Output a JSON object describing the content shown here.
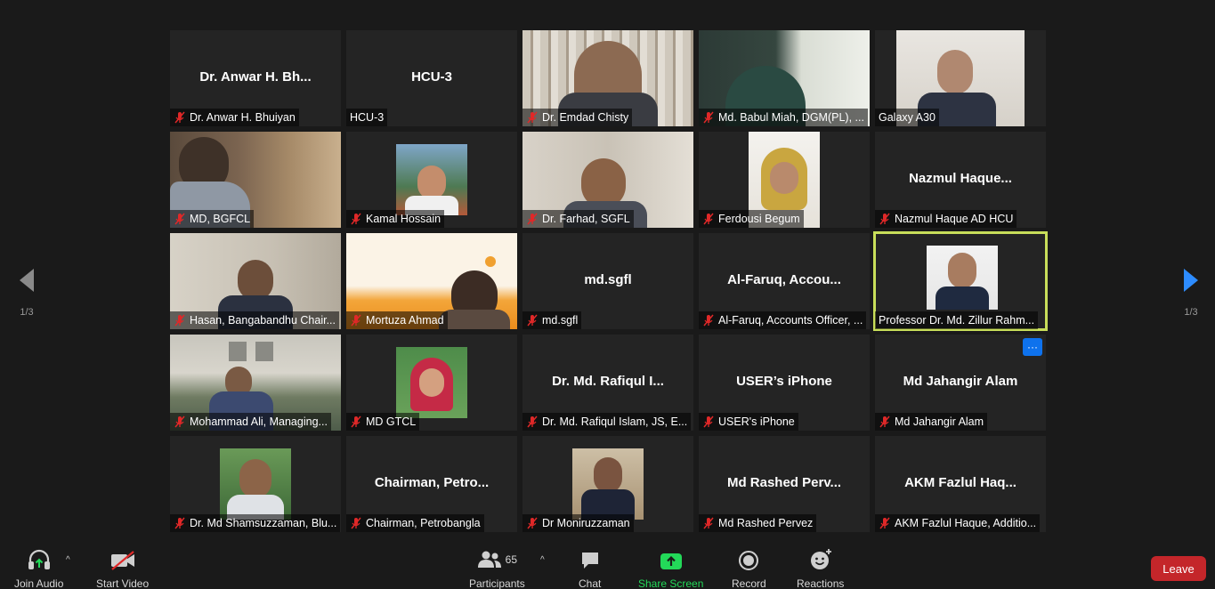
{
  "pager": {
    "left_label": "1/3",
    "right_label": "1/3"
  },
  "tiles": [
    {
      "name": "Dr. Anwar H. Bhuiyan",
      "display": "Dr. Anwar H. Bh...",
      "muted": true
    },
    {
      "name": "HCU-3",
      "display": "HCU-3",
      "muted": false
    },
    {
      "name": "Dr. Emdad Chisty",
      "muted": true
    },
    {
      "name": "Md. Babul Miah, DGM(PL), ...",
      "muted": true
    },
    {
      "name": "Galaxy A30",
      "muted": false
    },
    {
      "name": "MD, BGFCL",
      "muted": true
    },
    {
      "name": "Kamal Hossain",
      "muted": true
    },
    {
      "name": "Dr. Farhad, SGFL",
      "muted": true
    },
    {
      "name": "Ferdousi Begum",
      "muted": true
    },
    {
      "name": "Nazmul Haque AD HCU",
      "display": "Nazmul  Haque...",
      "muted": true
    },
    {
      "name": "Hasan, Bangabandhu Chair...",
      "muted": true
    },
    {
      "name": "Mortuza Ahmad",
      "muted": true
    },
    {
      "name": "md.sgfl",
      "display": "md.sgfl",
      "muted": true
    },
    {
      "name": "Al-Faruq, Accounts Officer, ...",
      "display": "Al-Faruq,  Accou...",
      "muted": true
    },
    {
      "name": "Professor Dr. Md. Zillur Rahm...",
      "muted": false
    },
    {
      "name": "Mohammad Ali, Managing...",
      "muted": true
    },
    {
      "name": "MD GTCL",
      "muted": true
    },
    {
      "name": "Dr. Md. Rafiqul Islam, JS, E...",
      "display": "Dr.  Md.  Rafiqul  I...",
      "muted": true
    },
    {
      "name": "USER's iPhone",
      "display": "USER’s iPhone",
      "muted": true
    },
    {
      "name": "Md Jahangir Alam",
      "display": "Md Jahangir Alam",
      "muted": true,
      "more_label": "···"
    },
    {
      "name": "Dr. Md Shamsuzzaman, Blu...",
      "muted": true
    },
    {
      "name": "Chairman, Petrobangla",
      "display": "Chairman,  Petro...",
      "muted": true
    },
    {
      "name": "Dr Moniruzzaman",
      "muted": true
    },
    {
      "name": "Md Rashed Pervez",
      "display": "Md Rashed Perv...",
      "muted": true
    },
    {
      "name": "AKM Fazlul Haque, Additio...",
      "display": "AKM  Fazlul  Haq...",
      "muted": true
    }
  ],
  "toolbar": {
    "join_audio": "Join Audio",
    "start_video": "Start Video",
    "participants": "Participants",
    "participants_count": "65",
    "chat": "Chat",
    "share_screen": "Share Screen",
    "record": "Record",
    "reactions": "Reactions",
    "leave": "Leave"
  },
  "colors": {
    "accent_green": "#23d959",
    "active_speaker": "#c8de5a",
    "leave_red": "#c4262a",
    "mute_red": "#e02828",
    "more_blue": "#0e72ed"
  }
}
